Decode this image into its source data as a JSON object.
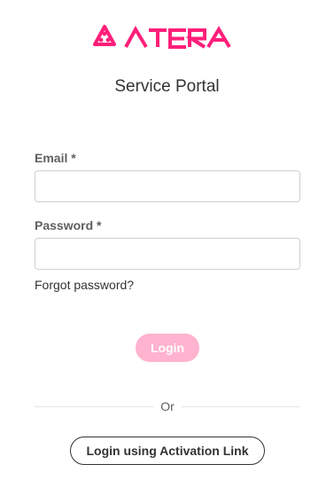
{
  "brand": {
    "logo_icon": "atera-logo-icon",
    "logo_text": "ATERA",
    "accent_color": "#ff1f7a"
  },
  "page": {
    "title": "Service Portal"
  },
  "form": {
    "email_label": "Email *",
    "email_value": "",
    "password_label": "Password *",
    "password_value": "",
    "forgot_password": "Forgot password?",
    "login_label": "Login",
    "login_button_color": "#ffb3cf"
  },
  "divider": {
    "text": "Or"
  },
  "alt_login": {
    "label": "Login using Activation Link"
  }
}
